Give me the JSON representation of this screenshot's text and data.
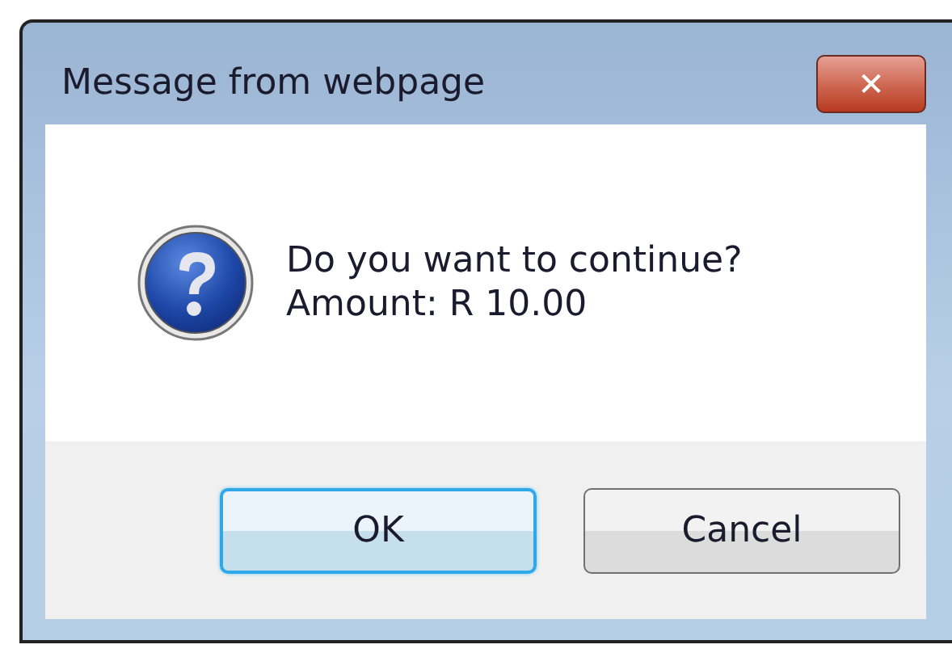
{
  "window": {
    "title": "Message from webpage",
    "close_button": "✕"
  },
  "message": {
    "lines": [
      "Do you want to continue?",
      "Amount: R 10.00"
    ]
  },
  "buttons": [
    {
      "label": "OK",
      "default": true
    },
    {
      "label": "Cancel",
      "default": false
    }
  ]
}
